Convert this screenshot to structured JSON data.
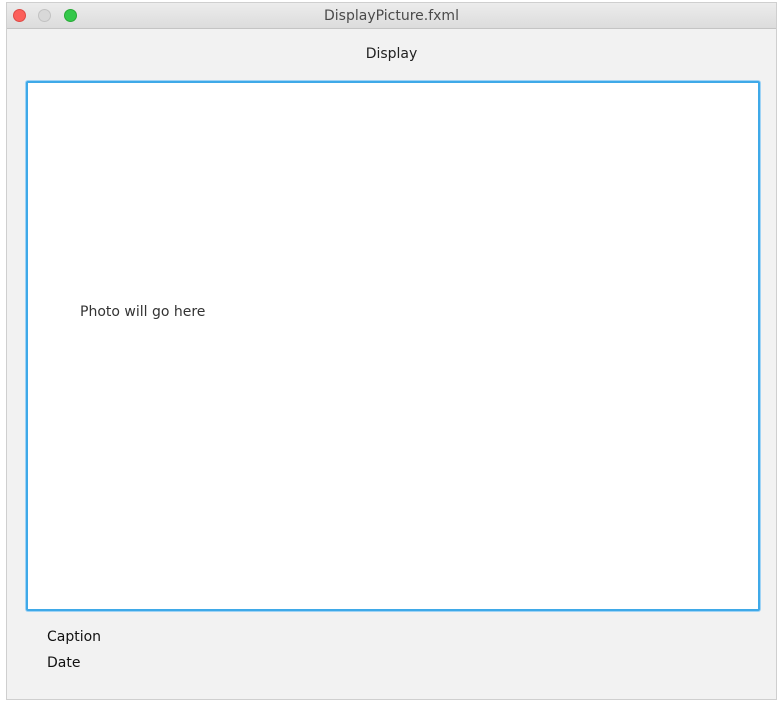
{
  "window": {
    "title": "DisplayPicture.fxml"
  },
  "header": {
    "title": "Display"
  },
  "photo": {
    "placeholder": "Photo will go here"
  },
  "details": {
    "caption_label": "Caption",
    "date_label": "Date"
  },
  "colors": {
    "focus_border": "#3fa9e8",
    "close": "#fc605b",
    "zoom": "#34c84a",
    "minimize": "#d8d8d8"
  }
}
